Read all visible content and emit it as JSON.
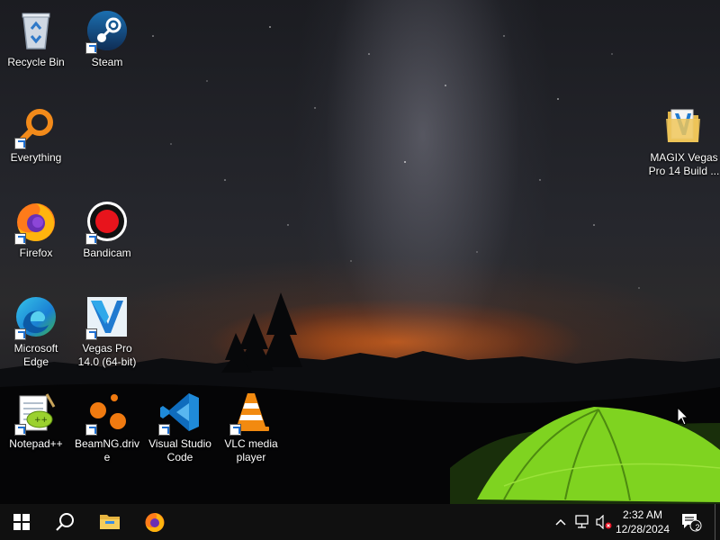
{
  "desktop": {
    "icons": [
      {
        "label": "Recycle Bin",
        "icon": "recycle-bin-icon"
      },
      {
        "label": "Steam",
        "icon": "steam-icon"
      },
      {
        "label": "Everything",
        "icon": "everything-search-icon"
      },
      {
        "label": "Firefox",
        "icon": "firefox-icon"
      },
      {
        "label": "Bandicam",
        "icon": "bandicam-record-icon"
      },
      {
        "label": "Microsoft Edge",
        "icon": "edge-icon"
      },
      {
        "label": "Vegas Pro 14.0 (64-bit)",
        "icon": "vegas-pro-icon"
      },
      {
        "label": "Notepad++",
        "icon": "notepad-plus-plus-icon"
      },
      {
        "label": "BeamNG.drive",
        "icon": "beamng-icon"
      },
      {
        "label": "Visual Studio Code",
        "icon": "vscode-icon"
      },
      {
        "label": "VLC media player",
        "icon": "vlc-cone-icon"
      },
      {
        "label": "MAGIX Vegas Pro 14 Build ...",
        "icon": "folder-icon"
      }
    ]
  },
  "taskbar": {
    "pinned": [
      "start-windows-icon",
      "search-icon",
      "file-explorer-icon",
      "firefox-icon"
    ],
    "tray": {
      "overflow_icon": "chevron-up-icon",
      "network_icon": "network-icon",
      "volume_icon": "volume-muted-icon",
      "clock_time": "2:32 AM",
      "clock_date": "12/28/2024",
      "notification_count": "2"
    }
  },
  "colors": {
    "taskbar": "#101010",
    "accent_blue": "#1f6fd0",
    "tent_green": "#7fd320",
    "horizon_orange": "#e0641a"
  }
}
